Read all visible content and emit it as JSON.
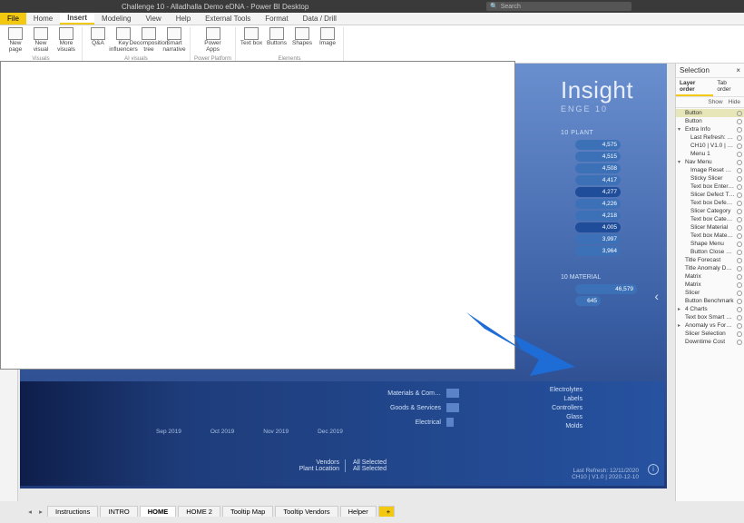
{
  "titlebar": {
    "title": "Challenge 10 - Alladhalla Demo eDNA - Power BI Desktop",
    "search_placeholder": "Search"
  },
  "menubar": {
    "file": "File",
    "tabs": [
      "Home",
      "Insert",
      "Modeling",
      "View",
      "Help",
      "External Tools",
      "Format",
      "Data / Drill"
    ],
    "active": "Insert"
  },
  "ribbon": {
    "groups": [
      {
        "name": "Visuals",
        "buttons": [
          {
            "label": "New page"
          },
          {
            "label": "New visual"
          },
          {
            "label": "More visuals"
          },
          {
            "label": "Q&A"
          },
          {
            "label": "Key influencers"
          },
          {
            "label": "Decomposition tree"
          },
          {
            "label": "Smart narrative"
          }
        ]
      },
      {
        "name": "AI visuals",
        "buttons": [
          {
            "label": "Power Apps"
          }
        ]
      },
      {
        "name": "Power Platform",
        "buttons": [
          {
            "label": "Text box"
          },
          {
            "label": "Buttons"
          },
          {
            "label": "Shapes"
          },
          {
            "label": "Image"
          }
        ]
      },
      {
        "name": "Elements",
        "buttons": []
      }
    ]
  },
  "report_fragment": {
    "brand": "Insight",
    "sub": "ENGE 10",
    "plant_head": "10 PLANT",
    "plant_values": [
      "4,575",
      "4,515",
      "4,508",
      "4,417",
      "4,277",
      "4,226",
      "4,218",
      "4,005",
      "3,997",
      "3,964"
    ],
    "material_head": "10 MATERIAL",
    "material_rows": [
      {
        "value": "46,579",
        "cls": "w1"
      },
      {
        "value": "645",
        "cls": "w2"
      }
    ]
  },
  "bottom_strip": {
    "mid_bars": [
      {
        "label": "Materials & Com…",
        "width": 14
      },
      {
        "label": "Goods & Services",
        "width": 14
      },
      {
        "label": "Electrical",
        "width": 8
      }
    ],
    "right_list": [
      "Electrolytes",
      "Labels",
      "Controllers",
      "Glass",
      "Molds"
    ],
    "xaxis": [
      "Sep 2019",
      "Oct 2019",
      "Nov 2019",
      "Dec 2019"
    ],
    "filters": [
      {
        "label": "Vendors",
        "value": "All Selected"
      },
      {
        "label": "Plant Location",
        "value": "All Selected"
      }
    ],
    "refresh_line1": "Last Refresh: 12/11/2020",
    "refresh_line2": "CH10 | V1.0 | 2020-12-10"
  },
  "selection_pane": {
    "title": "Selection",
    "close": "×",
    "tabs": {
      "layer": "Layer order",
      "tab": "Tab order"
    },
    "tools": {
      "show": "Show",
      "hide": "Hide"
    },
    "items": [
      {
        "label": "Button",
        "sel": true
      },
      {
        "label": "Button"
      },
      {
        "label": "Extra Info",
        "exp": true
      },
      {
        "label": "Last Refresh: 12/11/…",
        "indent": true
      },
      {
        "label": "CH10 | V1.0 | 2020-1…",
        "indent": true
      },
      {
        "label": "Menu 1",
        "indent": true
      },
      {
        "label": "Nav Menu",
        "exp": true
      },
      {
        "label": "Image Reset Filters",
        "indent": true
      },
      {
        "label": "Sticky Slicer",
        "indent": true
      },
      {
        "label": "Text box Enter Cust",
        "indent": true
      },
      {
        "label": "Slicer Defect Type",
        "indent": true
      },
      {
        "label": "Text box Defect T…",
        "indent": true
      },
      {
        "label": "Slicer Category",
        "indent": true
      },
      {
        "label": "Text box Category",
        "indent": true
      },
      {
        "label": "Slicer Material",
        "indent": true
      },
      {
        "label": "Text box Material",
        "indent": true
      },
      {
        "label": "Shape Menu",
        "indent": true
      },
      {
        "label": "Button Close Nav…",
        "indent": true
      },
      {
        "label": "Title Forecast"
      },
      {
        "label": "Title Anomaly Detect…"
      },
      {
        "label": "Matrix"
      },
      {
        "label": "Matrix"
      },
      {
        "label": "Slicer"
      },
      {
        "label": "Button Benchmark"
      },
      {
        "label": "4 Charts",
        "exp": false
      },
      {
        "label": "Text box Smart Narra…"
      },
      {
        "label": "Anomaly vs Forecast",
        "exp": false
      },
      {
        "label": "Slicer Selection"
      },
      {
        "label": "Downtime Cost"
      }
    ]
  },
  "sheet_tabs": {
    "tabs": [
      "Instructions",
      "INTRO",
      "HOME",
      "HOME 2",
      "Tooltip Map",
      "Tooltip Vendors",
      "Helper"
    ],
    "active": "HOME",
    "add": "+"
  }
}
